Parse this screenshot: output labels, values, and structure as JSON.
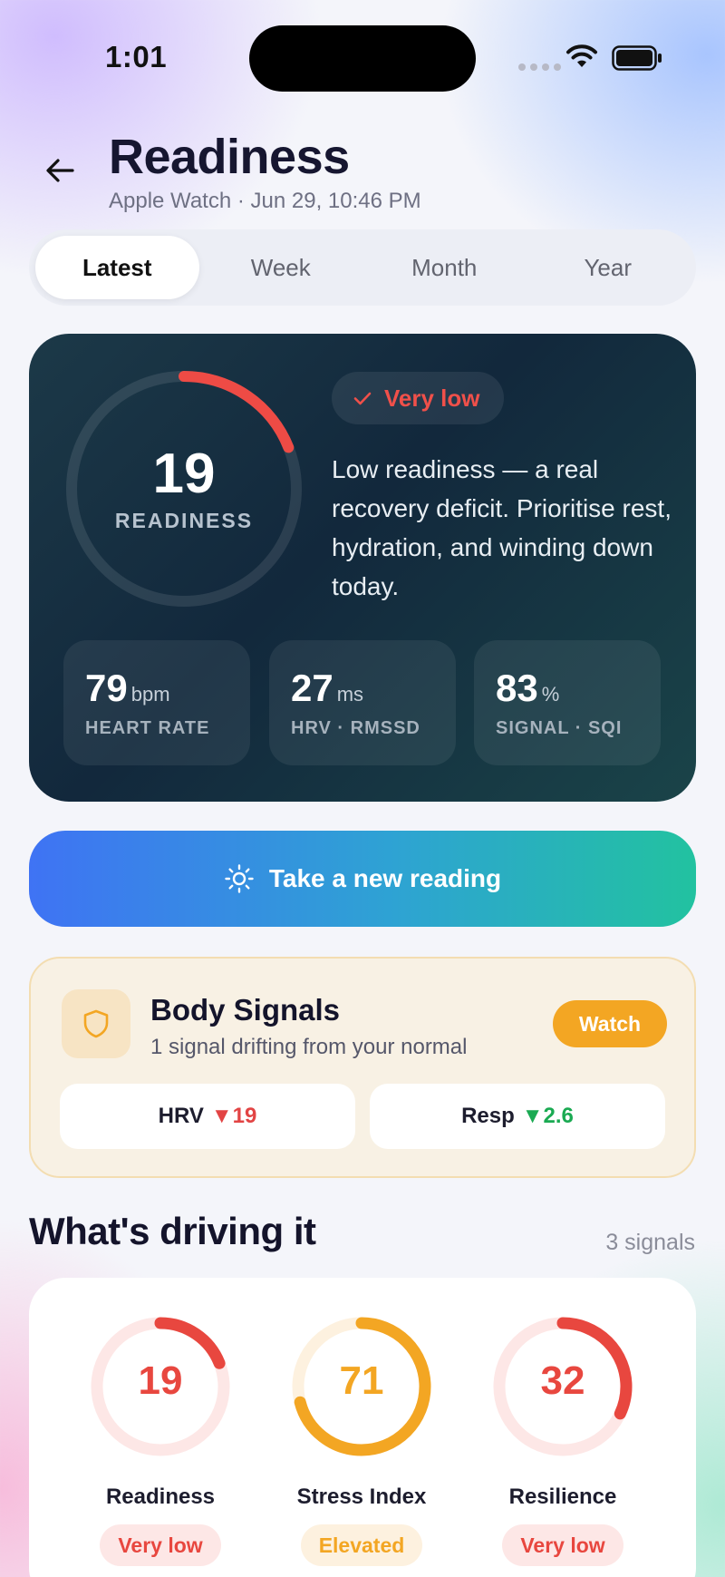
{
  "status_bar": {
    "time": "1:01"
  },
  "header": {
    "title": "Readiness",
    "subtitle": "Apple Watch · Jun 29, 10:46 PM"
  },
  "tabs": [
    {
      "label": "Latest",
      "active": true
    },
    {
      "label": "Week",
      "active": false
    },
    {
      "label": "Month",
      "active": false
    },
    {
      "label": "Year",
      "active": false
    }
  ],
  "hero": {
    "score": "19",
    "score_value": 19,
    "score_max": 100,
    "score_label": "READINESS",
    "status": "Very low",
    "description": "Low readiness — a real recovery deficit. Prioritise rest, hydration, and winding down today.",
    "metrics": [
      {
        "value": "79",
        "unit": "bpm",
        "label": "HEART RATE"
      },
      {
        "value": "27",
        "unit": "ms",
        "label": "HRV · RMSSD"
      },
      {
        "value": "83",
        "unit": "%",
        "label": "SIGNAL · SQI"
      }
    ]
  },
  "cta": {
    "label": "Take a new reading"
  },
  "body_signals": {
    "title": "Body Signals",
    "subtitle": "1 signal drifting from your normal",
    "badge": "Watch",
    "chips": [
      {
        "name": "HRV",
        "delta": "▼19",
        "tone": "red"
      },
      {
        "name": "Resp",
        "delta": "▼2.6",
        "tone": "green"
      }
    ]
  },
  "drivers": {
    "title": "What's driving it",
    "count": "3 signals",
    "items": [
      {
        "value": "19",
        "fraction": 0.19,
        "name": "Readiness",
        "status": "Very low",
        "color": "#e8473f",
        "track": "#fde7e6",
        "badge_bg": "#fde7e6"
      },
      {
        "value": "71",
        "fraction": 0.71,
        "name": "Stress Index",
        "status": "Elevated",
        "color": "#f3a623",
        "track": "#fdf1df",
        "badge_bg": "#fdf1df"
      },
      {
        "value": "32",
        "fraction": 0.32,
        "name": "Resilience",
        "status": "Very low",
        "color": "#e8473f",
        "track": "#fde7e6",
        "badge_bg": "#fde7e6"
      }
    ]
  },
  "colors": {
    "accent_red": "#e8473f",
    "accent_amber": "#f3a623",
    "accent_green": "#1aaa52"
  }
}
